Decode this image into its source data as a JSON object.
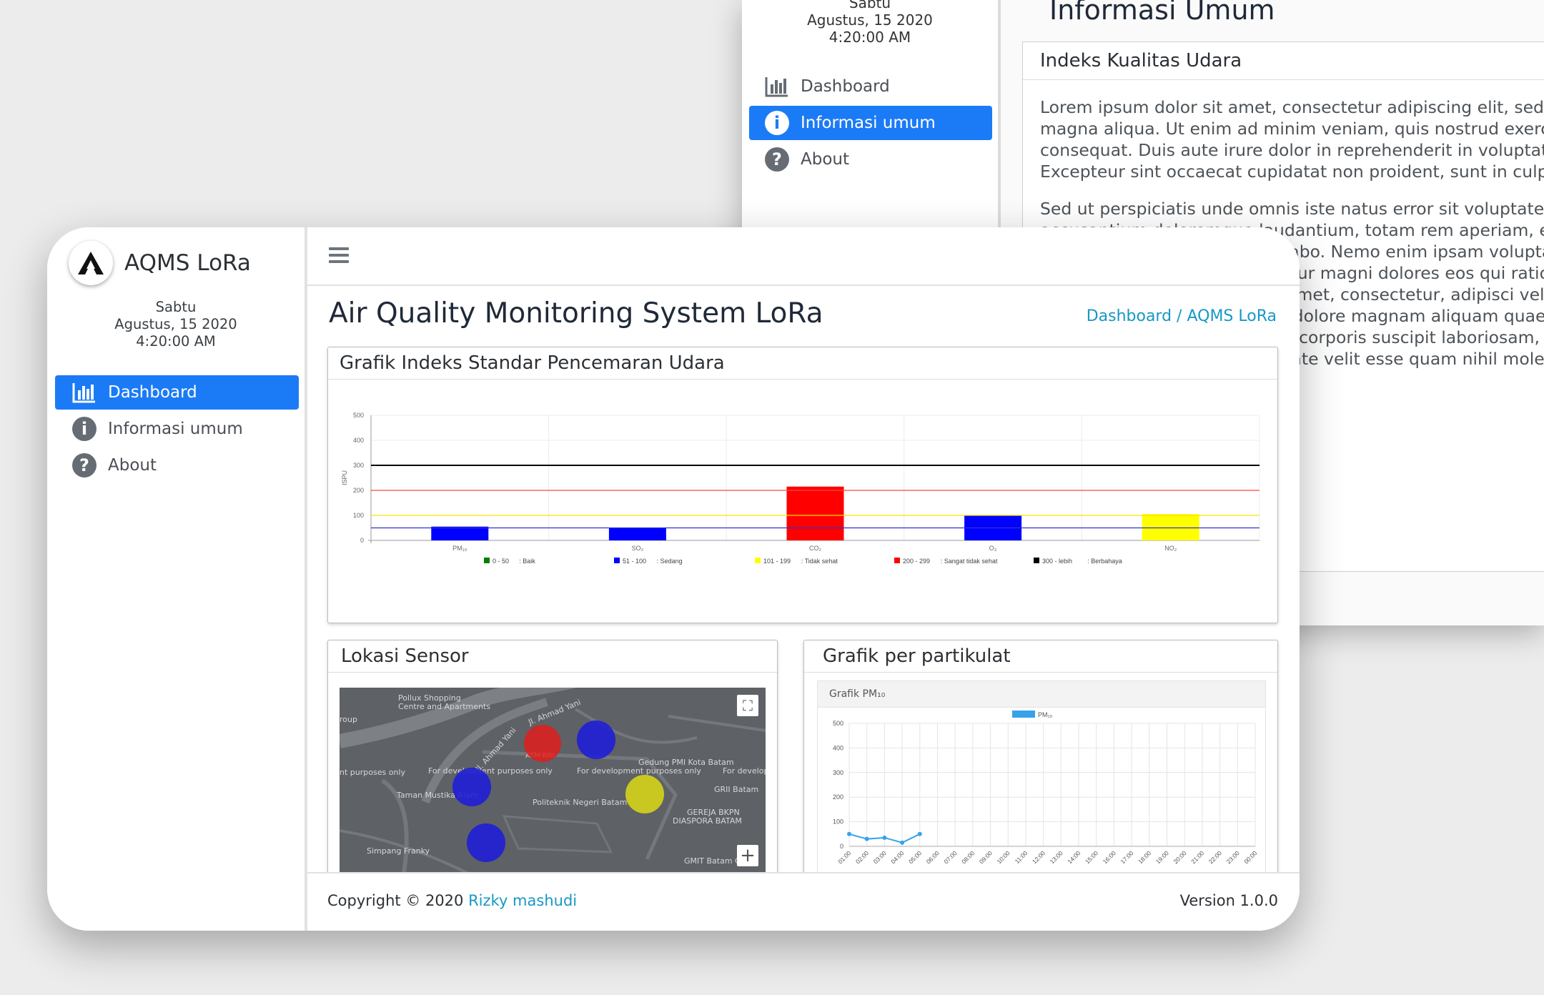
{
  "background_window": {
    "date": {
      "day": "Sabtu",
      "date": "Agustus, 15 2020",
      "time": "4:20:00 AM"
    },
    "nav": [
      {
        "label": "Dashboard",
        "icon": "bar-chart-icon",
        "active": false
      },
      {
        "label": "Informasi umum",
        "icon": "info-icon",
        "active": true
      },
      {
        "label": "About",
        "icon": "question-icon",
        "active": false
      }
    ],
    "page_title": "Informasi Umum",
    "card_title": "Indeks Kualitas Udara",
    "paragraph1": [
      "Lorem ipsum dolor sit amet, consectetur adipiscing elit, sed",
      "magna aliqua. Ut enim ad minim veniam, quis nostrud exercita",
      "consequat. Duis aute irure dolor in reprehenderit in voluptate",
      "Excepteur sint occaecat cupidatat non proident, sunt in culpa qu"
    ],
    "paragraph2": [
      "Sed ut perspiciatis unde omnis iste natus error sit voluptatem",
      "accusantium doloremque laudantium, totam rem aperiam, eaque ipsa quae ab illo inventore veritatis et quasi a",
      "beatae vitae dicta sunt explicabo. Nemo enim ipsam voluptatem quia voluptas sit aspernatur aut odit a",
      "aut fugit, sed quia consequuntur magni dolores eos qui ratione voluptatem sequi nesciunt. Neque porro quisqu",
      "dolorem ipsum quia dolor sit amet, consectetur, adipisci velit, sed quia non numquam eius mod",
      "tempora incidunt ut labore et dolore magnam aliquam quaerat voluptatem. Ut enim ad minima veniam, qui",
      "nostrum exercitationem ullam corporis suscipit laboriosam, nisi ut aliquid ex ea commodi consequatur? Quis a",
      "reprehenderit qui in ea voluptate velit esse quam nihil molestiae consequatur, vel illum qui dolore"
    ]
  },
  "app": {
    "brand": "AQMS LoRa",
    "date": {
      "day": "Sabtu",
      "date": "Agustus, 15 2020",
      "time": "4:20:00 AM"
    },
    "nav": [
      {
        "label": "Dashboard",
        "icon": "bar-chart-icon",
        "active": true
      },
      {
        "label": "Informasi umum",
        "icon": "info-icon",
        "active": false
      },
      {
        "label": "About",
        "icon": "question-icon",
        "active": false
      }
    ],
    "page_title": "Air Quality Monitoring System LoRa",
    "breadcrumb": "Dashboard / AQMS LoRa",
    "ispu_card_title": "Grafik Indeks Standar Pencemaran Udara",
    "map_card_title": "Lokasi Sensor",
    "particulate_card_title": "Grafik per partikulat",
    "particulate_subtitle": "Grafik PM₁₀",
    "footer": {
      "copyright": "Copyright © 2020 ",
      "author": "Rizky mashudi",
      "version": "Version 1.0.0"
    }
  },
  "map": {
    "labels": [
      {
        "text": "Pollux Shopping"
      },
      {
        "text": "Centre and Apartments"
      },
      {
        "text": "Jl. Ahmad Yani"
      },
      {
        "text": "Jl. Ahmad Yani"
      },
      {
        "text": "For development purposes only"
      },
      {
        "text": "nt purposes only"
      },
      {
        "text": "For development purposes only"
      },
      {
        "text": "For develop"
      },
      {
        "text": "Gedung PMI Kota Batam"
      },
      {
        "text": "GRII Batam"
      },
      {
        "text": "Taman Mustika Alam"
      },
      {
        "text": "Politeknik Negeri Batam"
      },
      {
        "text": "GEREJA BKPN"
      },
      {
        "text": "DIASPORA BATAM"
      },
      {
        "text": "Simpang Franky"
      },
      {
        "text": "GMIT Batam C"
      },
      {
        "text": "ATM BRI"
      },
      {
        "text": "roup"
      }
    ],
    "sensors": [
      {
        "color": "#e11d1d"
      },
      {
        "color": "#1f1fd6"
      },
      {
        "color": "#1f1fd6"
      },
      {
        "color": "#d4d41a"
      },
      {
        "color": "#1f1fd6"
      }
    ],
    "buttons": {
      "fullscreen": "⛶",
      "zoom_in": "+"
    }
  },
  "chart_data": [
    {
      "type": "bar",
      "title": "",
      "ylabel": "ISPU",
      "ylim": [
        0,
        500
      ],
      "yticks": [
        0,
        100,
        200,
        300,
        400,
        500
      ],
      "categories": [
        "PM₁₀",
        "SO₂",
        "CO₂",
        "O₃",
        "NO₂"
      ],
      "values": [
        55,
        50,
        215,
        100,
        105
      ],
      "bar_colors": [
        "#0000ff",
        "#0000ff",
        "#ff0000",
        "#0000ff",
        "#ffff00"
      ],
      "thresholds": [
        {
          "value": 50,
          "color": "#3333cc"
        },
        {
          "value": 100,
          "color": "#ffe100"
        },
        {
          "value": 200,
          "color": "#ff4444"
        },
        {
          "value": 300,
          "color": "#000000"
        }
      ],
      "legend": [
        {
          "color": "#008000",
          "range": "0 - 50",
          "label": "Baik"
        },
        {
          "color": "#0000ff",
          "range": "51 - 100",
          "label": "Sedang"
        },
        {
          "color": "#ffff00",
          "range": "101 - 199",
          "label": "Tidak sehat"
        },
        {
          "color": "#ff0000",
          "range": "200 - 299",
          "label": "Sangat tidak sehat"
        },
        {
          "color": "#000000",
          "range": "300 - lebih",
          "label": "Berbahaya"
        }
      ],
      "grid": true,
      "legend_position": "bottom"
    },
    {
      "type": "line",
      "title": "Grafik PM₁₀",
      "series": [
        {
          "name": "PM₁₀",
          "color": "#36a2eb",
          "values": [
            50,
            30,
            35,
            15,
            50
          ]
        }
      ],
      "categories": [
        "01:00",
        "02:00",
        "03:00",
        "04:00",
        "05:00",
        "06:00",
        "07:00",
        "08:00",
        "09:00",
        "10:00",
        "11:00",
        "12:00",
        "13:00",
        "14:00",
        "15:00",
        "16:00",
        "17:00",
        "18:00",
        "19:00",
        "20:00",
        "21:00",
        "22:00",
        "23:00",
        "00:00"
      ],
      "ylim": [
        0,
        500
      ],
      "yticks": [
        0,
        100,
        200,
        300,
        400,
        500
      ],
      "grid": true,
      "legend_position": "top"
    }
  ]
}
